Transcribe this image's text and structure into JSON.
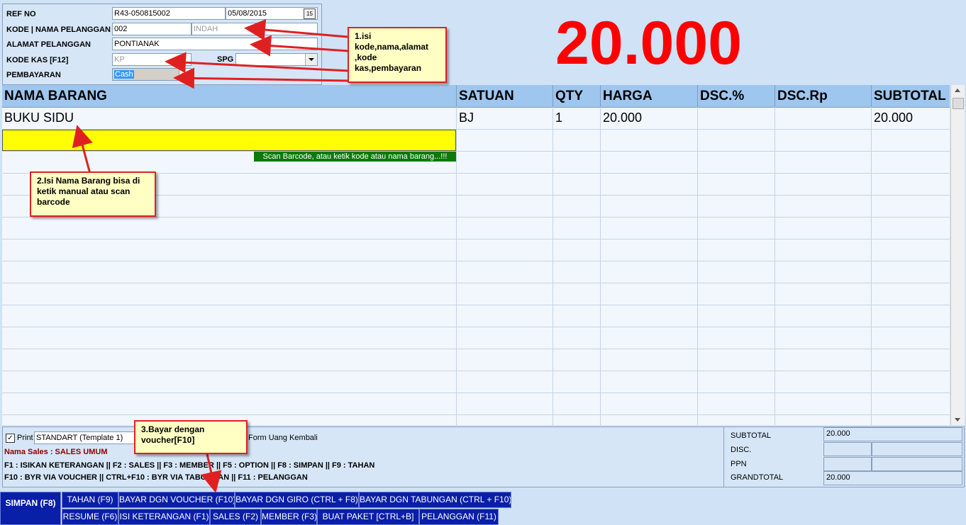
{
  "header": {
    "ref_label": "REF NO",
    "ref_value": "R43-050815002",
    "date_value": "05/08/2015",
    "calendar_glyph": "15",
    "customer_label": "KODE | NAMA PELANGGAN",
    "customer_code": "002",
    "customer_name": "INDAH",
    "address_label": "ALAMAT PELANGGAN",
    "address_value": "PONTIANAK",
    "cash_label": "KODE KAS [F12]",
    "cash_value": "KP",
    "spg_label": "SPG",
    "spg_value": "",
    "payment_label": "PEMBAYARAN",
    "payment_value": "Cash"
  },
  "total_display": "20.000",
  "grid": {
    "columns": [
      "NAMA BARANG",
      "SATUAN",
      "QTY",
      "HARGA",
      "DSC.%",
      "DSC.Rp",
      "SUBTOTAL"
    ],
    "rows": [
      {
        "name": "BUKU SIDU",
        "unit": "BJ",
        "qty": "1",
        "price": "20.000",
        "disc_pct": "",
        "disc_rp": "",
        "subtotal": "20.000"
      }
    ],
    "input_hint": "Scan Barcode, atau ketik kode atau nama barang...!!!"
  },
  "callouts": {
    "note1": "1.isi kode,nama,alamat ,kode kas,pembayaran",
    "note2": "2.Isi Nama Barang bisa di ketik manual atau scan barcode",
    "note3": "3.Bayar dengan voucher[F10]"
  },
  "footer": {
    "print_label": "Print",
    "template_value": "STANDART (Template 1)",
    "form_label": "Form Uang Kembali",
    "sales_name": "Nama Sales : SALES UMUM",
    "shortcuts1": "F1 : ISIKAN KETERANGAN || F2 : SALES || F3 : MEMBER || F5 : OPTION || F8 : SIMPAN || F9 : TAHAN",
    "shortcuts2": "F10 : BYR VIA VOUCHER || CTRL+F10 : BYR VIA TABUNGAN || F11 : PELANGGAN"
  },
  "summary": {
    "subtotal_label": "SUBTOTAL",
    "subtotal_value": "20.000",
    "disc_label": "DISC.",
    "ppn_label": "PPN",
    "grandtotal_label": "GRANDTOTAL",
    "grandtotal_value": "20.000"
  },
  "buttons": {
    "save": "SIMPAN (F8)",
    "hold": "TAHAN (F9)",
    "pay_voucher": "BAYAR DGN VOUCHER (F10)",
    "pay_giro": "BAYAR DGN GIRO (CTRL + F8)",
    "pay_savings": "BAYAR DGN TABUNGAN (CTRL + F10)",
    "resume": "RESUME (F6)",
    "remarks": "ISI KETERANGAN (F1)",
    "sales": "SALES (F2)",
    "member": "MEMBER (F3)",
    "package": "BUAT PAKET [CTRL+B]",
    "customer": "PELANGGAN (F11)"
  }
}
